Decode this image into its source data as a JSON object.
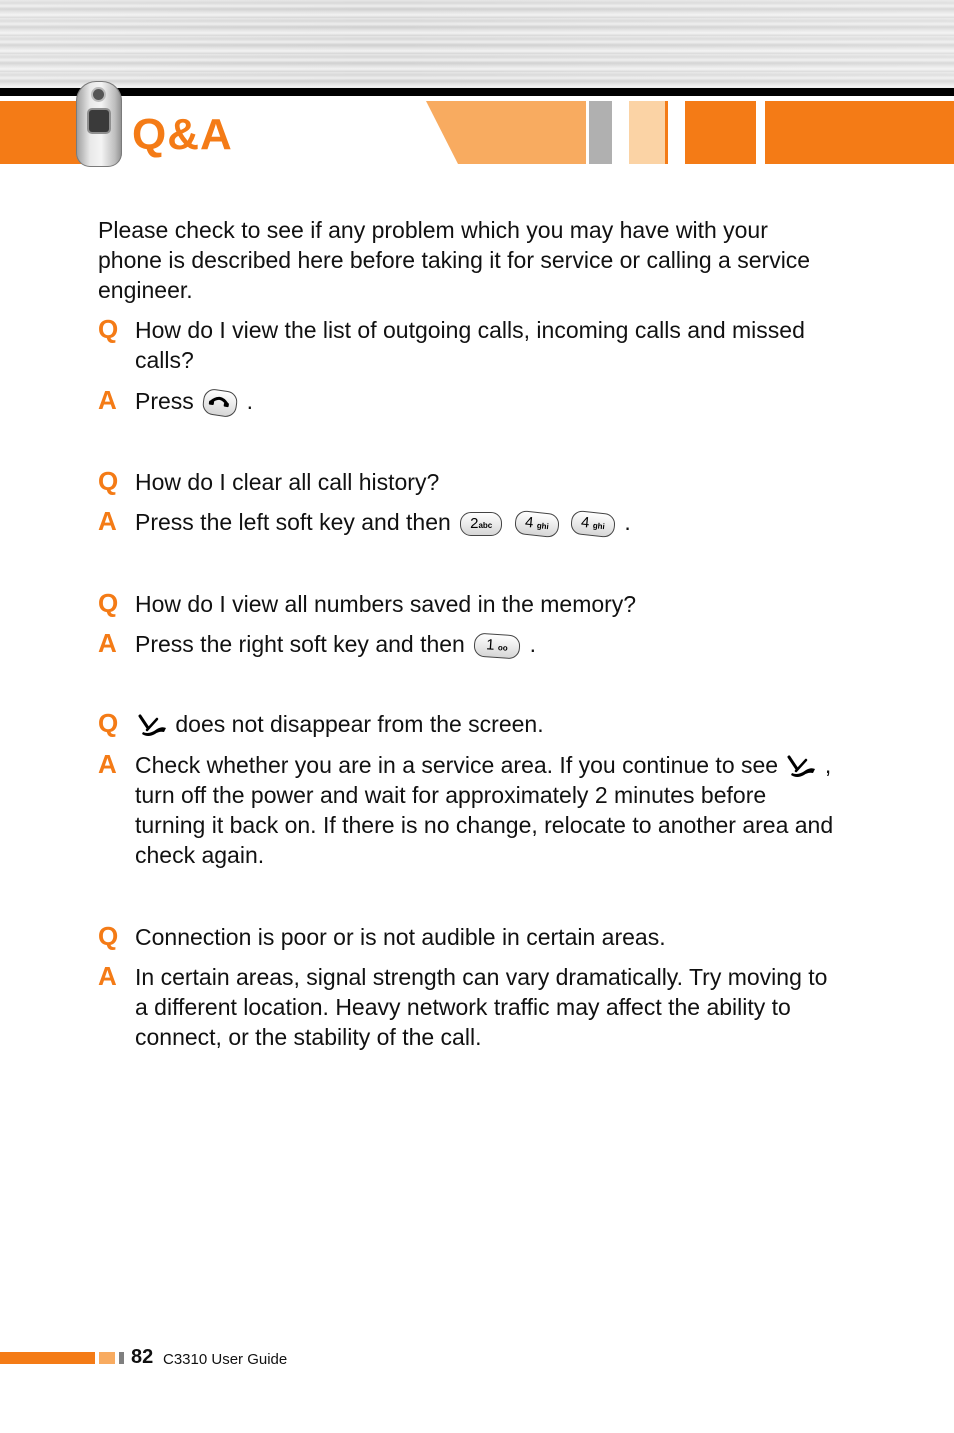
{
  "colors": {
    "orange": "#f47b16",
    "light_orange": "#f8ab60",
    "pale_orange": "#fbd3a5",
    "gray": "#b0b0b0",
    "footer_gray": "#7f7f7f"
  },
  "header": {
    "title": "Q&A",
    "image": "lg-flip-phone"
  },
  "intro": "Please check to see if any problem which you may have with your phone is described here before taking it for service or calling a service engineer.",
  "qa_marks": {
    "q": "Q",
    "a": "A"
  },
  "items": [
    {
      "question": "How do I view the list of outgoing calls, incoming calls and missed calls?",
      "answer_before": "Press",
      "answer_keys": [
        "send-key"
      ],
      "answer_after": "."
    },
    {
      "question": "How do I clear all call history?",
      "answer_before": "Press the left soft key and then",
      "answer_keys": [
        {
          "num": "2",
          "sub": "abc"
        },
        {
          "num": "4",
          "sub": "ghi"
        },
        {
          "num": "4",
          "sub": "ghi"
        }
      ],
      "answer_after": "."
    },
    {
      "question": "How do I view all numbers saved in the memory?",
      "answer_before": "Press the right soft key and then",
      "answer_keys": [
        {
          "num": "1",
          "sub": "oo"
        }
      ],
      "answer_after": "."
    },
    {
      "question_icon": "no-service-icon",
      "question": "does not disappear from the screen.",
      "answer_before": "Check whether you are in a service area. If you continue to see",
      "answer_icon": "no-service-icon",
      "answer_after": ", turn off the power and wait for approximately 2 minutes before turning it back on. If there is no change, relocate to another area and check again."
    },
    {
      "question": "Connection is poor or is not audible in certain areas.",
      "answer": "In certain areas, signal strength can vary dramatically. Try moving to a different location. Heavy network traffic may affect the ability to connect, or the stability of the call."
    }
  ],
  "footer": {
    "page_number": "82",
    "guide_title": "C3310 User Guide"
  }
}
